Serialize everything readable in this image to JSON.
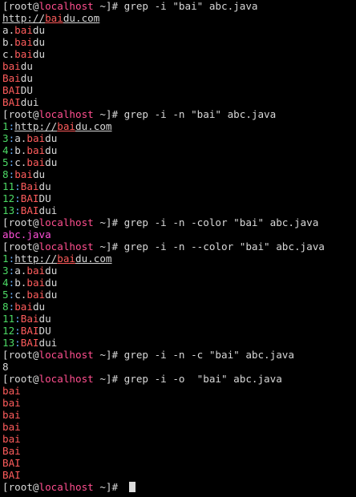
{
  "terminal": {
    "lines": [
      {
        "parts": [
          {
            "t": "[root@",
            "c": "prompt"
          },
          {
            "t": "localhost",
            "c": "host"
          },
          {
            "t": " ~]# ",
            "c": "prompt"
          },
          {
            "t": "grep -i \"bai\" abc.java",
            "c": "cmd"
          }
        ]
      },
      {
        "parts": [
          {
            "t": "http://",
            "c": "text",
            "u": true
          },
          {
            "t": "bai",
            "c": "match",
            "u": true
          },
          {
            "t": "du.com",
            "c": "text",
            "u": true
          }
        ]
      },
      {
        "parts": [
          {
            "t": "a.",
            "c": "text"
          },
          {
            "t": "bai",
            "c": "match"
          },
          {
            "t": "du",
            "c": "text"
          }
        ]
      },
      {
        "parts": [
          {
            "t": "b.",
            "c": "text"
          },
          {
            "t": "bai",
            "c": "match"
          },
          {
            "t": "du",
            "c": "text"
          }
        ]
      },
      {
        "parts": [
          {
            "t": "c.",
            "c": "text"
          },
          {
            "t": "bai",
            "c": "match"
          },
          {
            "t": "du",
            "c": "text"
          }
        ]
      },
      {
        "parts": [
          {
            "t": "bai",
            "c": "match"
          },
          {
            "t": "du",
            "c": "text"
          }
        ]
      },
      {
        "parts": [
          {
            "t": "Bai",
            "c": "match"
          },
          {
            "t": "du",
            "c": "text"
          }
        ]
      },
      {
        "parts": [
          {
            "t": "BAI",
            "c": "match"
          },
          {
            "t": "DU",
            "c": "text"
          }
        ]
      },
      {
        "parts": [
          {
            "t": "BAI",
            "c": "match"
          },
          {
            "t": "dui",
            "c": "text"
          }
        ]
      },
      {
        "parts": [
          {
            "t": "[root@",
            "c": "prompt"
          },
          {
            "t": "localhost",
            "c": "host"
          },
          {
            "t": " ~]# ",
            "c": "prompt"
          },
          {
            "t": "grep -i -n \"bai\" abc.java",
            "c": "cmd"
          }
        ]
      },
      {
        "parts": [
          {
            "t": "1",
            "c": "num"
          },
          {
            "t": ":",
            "c": "sep"
          },
          {
            "t": "http://",
            "c": "text",
            "u": true
          },
          {
            "t": "bai",
            "c": "match",
            "u": true
          },
          {
            "t": "du.com",
            "c": "text",
            "u": true
          }
        ]
      },
      {
        "parts": [
          {
            "t": "3",
            "c": "num"
          },
          {
            "t": ":",
            "c": "sep"
          },
          {
            "t": "a.",
            "c": "text"
          },
          {
            "t": "bai",
            "c": "match"
          },
          {
            "t": "du",
            "c": "text"
          }
        ]
      },
      {
        "parts": [
          {
            "t": "4",
            "c": "num"
          },
          {
            "t": ":",
            "c": "sep"
          },
          {
            "t": "b.",
            "c": "text"
          },
          {
            "t": "bai",
            "c": "match"
          },
          {
            "t": "du",
            "c": "text"
          }
        ]
      },
      {
        "parts": [
          {
            "t": "5",
            "c": "num"
          },
          {
            "t": ":",
            "c": "sep"
          },
          {
            "t": "c.",
            "c": "text"
          },
          {
            "t": "bai",
            "c": "match"
          },
          {
            "t": "du",
            "c": "text"
          }
        ]
      },
      {
        "parts": [
          {
            "t": "8",
            "c": "num"
          },
          {
            "t": ":",
            "c": "sep"
          },
          {
            "t": "bai",
            "c": "match"
          },
          {
            "t": "du",
            "c": "text"
          }
        ]
      },
      {
        "parts": [
          {
            "t": "11",
            "c": "num"
          },
          {
            "t": ":",
            "c": "sep"
          },
          {
            "t": "Bai",
            "c": "match"
          },
          {
            "t": "du",
            "c": "text"
          }
        ]
      },
      {
        "parts": [
          {
            "t": "12",
            "c": "num"
          },
          {
            "t": ":",
            "c": "sep"
          },
          {
            "t": "BAI",
            "c": "match"
          },
          {
            "t": "DU",
            "c": "text"
          }
        ]
      },
      {
        "parts": [
          {
            "t": "13",
            "c": "num"
          },
          {
            "t": ":",
            "c": "sep"
          },
          {
            "t": "BAI",
            "c": "match"
          },
          {
            "t": "dui",
            "c": "text"
          }
        ]
      },
      {
        "parts": [
          {
            "t": "[root@",
            "c": "prompt"
          },
          {
            "t": "localhost",
            "c": "host"
          },
          {
            "t": " ~]# ",
            "c": "prompt"
          },
          {
            "t": "grep -i -n -color \"bai\" abc.java",
            "c": "cmd"
          }
        ]
      },
      {
        "parts": [
          {
            "t": "abc.java",
            "c": "purple"
          }
        ]
      },
      {
        "parts": [
          {
            "t": "[root@",
            "c": "prompt"
          },
          {
            "t": "localhost",
            "c": "host"
          },
          {
            "t": " ~]# ",
            "c": "prompt"
          },
          {
            "t": "grep -i -n --color \"bai\" abc.java",
            "c": "cmd"
          }
        ]
      },
      {
        "parts": [
          {
            "t": "1",
            "c": "num"
          },
          {
            "t": ":",
            "c": "sep"
          },
          {
            "t": "http://",
            "c": "text",
            "u": true
          },
          {
            "t": "bai",
            "c": "match",
            "u": true
          },
          {
            "t": "du.com",
            "c": "text",
            "u": true
          }
        ]
      },
      {
        "parts": [
          {
            "t": "3",
            "c": "num"
          },
          {
            "t": ":",
            "c": "sep"
          },
          {
            "t": "a.",
            "c": "text"
          },
          {
            "t": "bai",
            "c": "match"
          },
          {
            "t": "du",
            "c": "text"
          }
        ]
      },
      {
        "parts": [
          {
            "t": "4",
            "c": "num"
          },
          {
            "t": ":",
            "c": "sep"
          },
          {
            "t": "b.",
            "c": "text"
          },
          {
            "t": "bai",
            "c": "match"
          },
          {
            "t": "du",
            "c": "text"
          }
        ]
      },
      {
        "parts": [
          {
            "t": "5",
            "c": "num"
          },
          {
            "t": ":",
            "c": "sep"
          },
          {
            "t": "c.",
            "c": "text"
          },
          {
            "t": "bai",
            "c": "match"
          },
          {
            "t": "du",
            "c": "text"
          }
        ]
      },
      {
        "parts": [
          {
            "t": "8",
            "c": "num"
          },
          {
            "t": ":",
            "c": "sep"
          },
          {
            "t": "bai",
            "c": "match"
          },
          {
            "t": "du",
            "c": "text"
          }
        ]
      },
      {
        "parts": [
          {
            "t": "11",
            "c": "num"
          },
          {
            "t": ":",
            "c": "sep"
          },
          {
            "t": "Bai",
            "c": "match"
          },
          {
            "t": "du",
            "c": "text"
          }
        ]
      },
      {
        "parts": [
          {
            "t": "12",
            "c": "num"
          },
          {
            "t": ":",
            "c": "sep"
          },
          {
            "t": "BAI",
            "c": "match"
          },
          {
            "t": "DU",
            "c": "text"
          }
        ]
      },
      {
        "parts": [
          {
            "t": "13",
            "c": "num"
          },
          {
            "t": ":",
            "c": "sep"
          },
          {
            "t": "BAI",
            "c": "match"
          },
          {
            "t": "dui",
            "c": "text"
          }
        ]
      },
      {
        "parts": [
          {
            "t": "[root@",
            "c": "prompt"
          },
          {
            "t": "localhost",
            "c": "host"
          },
          {
            "t": " ~]# ",
            "c": "prompt"
          },
          {
            "t": "grep -i -n -c \"bai\" abc.java",
            "c": "cmd"
          }
        ]
      },
      {
        "parts": [
          {
            "t": "8",
            "c": "text"
          }
        ]
      },
      {
        "parts": [
          {
            "t": "[root@",
            "c": "prompt"
          },
          {
            "t": "localhost",
            "c": "host"
          },
          {
            "t": " ~]# ",
            "c": "prompt"
          },
          {
            "t": "grep -i -o  \"bai\" abc.java",
            "c": "cmd"
          }
        ]
      },
      {
        "parts": [
          {
            "t": "bai",
            "c": "match"
          }
        ]
      },
      {
        "parts": [
          {
            "t": "bai",
            "c": "match"
          }
        ]
      },
      {
        "parts": [
          {
            "t": "bai",
            "c": "match"
          }
        ]
      },
      {
        "parts": [
          {
            "t": "bai",
            "c": "match"
          }
        ]
      },
      {
        "parts": [
          {
            "t": "bai",
            "c": "match"
          }
        ]
      },
      {
        "parts": [
          {
            "t": "Bai",
            "c": "match"
          }
        ]
      },
      {
        "parts": [
          {
            "t": "BAI",
            "c": "match"
          }
        ]
      },
      {
        "parts": [
          {
            "t": "BAI",
            "c": "match"
          }
        ]
      },
      {
        "parts": [
          {
            "t": "[root@",
            "c": "prompt"
          },
          {
            "t": "localhost",
            "c": "host"
          },
          {
            "t": " ~]# ",
            "c": "prompt"
          }
        ],
        "cursor": true
      }
    ]
  }
}
